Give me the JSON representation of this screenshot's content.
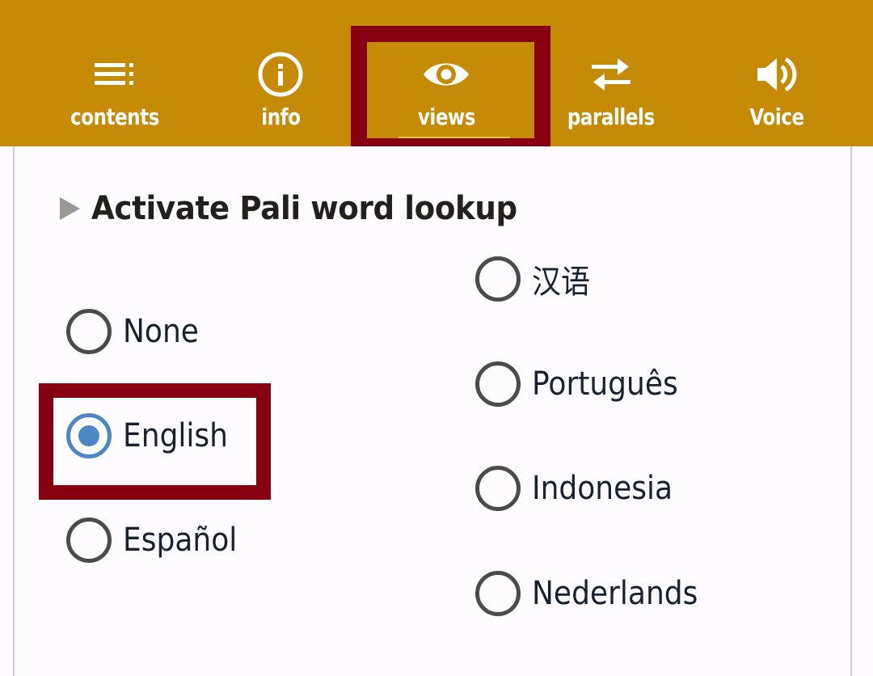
{
  "toolbar": {
    "background_color": "#c58b07",
    "highlight_color": "#860012",
    "tabs": [
      {
        "id": "contents",
        "label": "contents",
        "icon": "list-icon"
      },
      {
        "id": "info",
        "label": "info",
        "icon": "info-icon"
      },
      {
        "id": "views",
        "label": "views",
        "icon": "eye-icon",
        "active": true
      },
      {
        "id": "parallels",
        "label": "parallels",
        "icon": "swap-arrows-icon"
      },
      {
        "id": "voice",
        "label": "Voice",
        "icon": "speaker-icon"
      }
    ]
  },
  "lookup": {
    "title": "Activate Pali word lookup",
    "selected": "English",
    "accent_color": "#4c86c4",
    "options_left": [
      "None",
      "English",
      "Español"
    ],
    "options_right": [
      "汉语",
      "Português",
      "Indonesia",
      "Nederlands"
    ]
  }
}
